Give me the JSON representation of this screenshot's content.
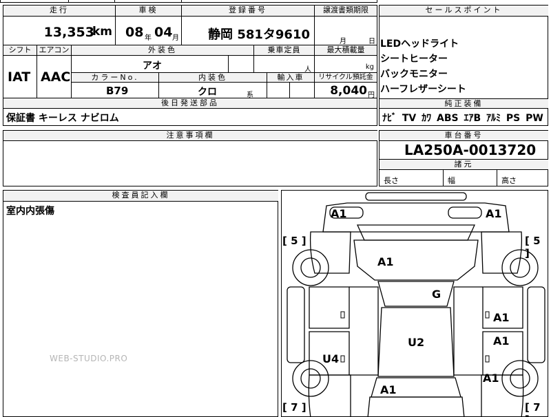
{
  "top": {
    "mileage_header": "走行",
    "mileage_value": "13,353",
    "mileage_unit": "km",
    "inspection_header": "車検",
    "inspection_year": "08",
    "inspection_year_unit": "年",
    "inspection_month": "04",
    "inspection_month_unit": "月",
    "registration_header": "登録番号",
    "registration_value": "静岡 581タ9610",
    "transfer_header": "譲渡書類期限",
    "transfer_month_unit": "月",
    "transfer_day_unit": "日"
  },
  "spec": {
    "shift_header": "シフト",
    "shift_value": "IAT",
    "ac_header": "エアコン",
    "ac_value": "AAC",
    "exterior_header": "外装色",
    "exterior_value": "アオ",
    "capacity_header": "乗車定員",
    "capacity_unit": "人",
    "load_header": "最大積載量",
    "load_unit": "kg",
    "color_no_header": "カラーNo.",
    "color_no_value": "B79",
    "interior_header": "内装色",
    "interior_value": "クロ",
    "interior_suffix": "系",
    "import_header": "輸入車",
    "recycle_header": "リサイクル預託金",
    "recycle_value": "8,040",
    "recycle_unit": "円"
  },
  "shipping": {
    "header": "後日発送部品",
    "value": "保証書 キーレス ナビロム"
  },
  "notes": {
    "header": "注意事項欄"
  },
  "selling_points": {
    "header": "セールスポイント",
    "items": [
      "LEDヘッドライト",
      "シートヒーター",
      "バックモニター",
      "ハーフレザーシート"
    ]
  },
  "equipment": {
    "header": "純正装備",
    "value": "ﾅﾋﾞ TV ｶﾜ ABS ｴｱB ｱﾙﾐ PS PW"
  },
  "chassis": {
    "header": "車台番号",
    "value": "LA250A-0013720"
  },
  "dimensions": {
    "header": "諸元",
    "length": "長さ",
    "width": "幅",
    "height": "高さ"
  },
  "inspector": {
    "header": "検査員記入欄",
    "value": "室内内張傷"
  },
  "diagram": {
    "marks": {
      "front_left": "A1",
      "front_right": "A1",
      "hood": "A1",
      "windshield": "G",
      "right_front": "A1",
      "right_mid": "A1",
      "roof": "U2",
      "left_side": "U4",
      "right_rear": "A1",
      "rear": "A1"
    },
    "wheel_labels": {
      "front_left": "5",
      "front_right": "5",
      "rear_left": "7",
      "rear_right": "7"
    },
    "watermark": "WEB-STUDIO.PRO"
  },
  "colors": {
    "header_bg": "#f2f2f2",
    "line": "#000000",
    "watermark": "#b5b5b5"
  }
}
